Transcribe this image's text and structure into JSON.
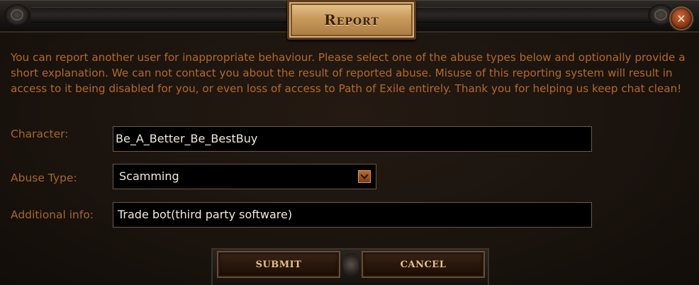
{
  "dialog": {
    "title": "Report",
    "close_icon": "close-icon",
    "message": "You can report another user for inappropriate behaviour. Please select one of the abuse types below and optionally provide a short explanation. We can not contact you about the result of reported abuse. Misuse of this reporting system will result in access to it being disabled for you, or even loss of access to Path of Exile entirely. Thank you for helping us keep chat clean!"
  },
  "form": {
    "character_label": "Character:",
    "character_value": "Be_A_Better_Be_BestBuy",
    "abuse_type_label": "Abuse Type:",
    "abuse_type_value": "Scamming",
    "additional_info_label": "Additional info:",
    "additional_info_value": "Trade bot(third party software)"
  },
  "buttons": {
    "submit_label": "SUBMIT",
    "cancel_label": "CANCEL"
  },
  "colors": {
    "message_text": "#b4692a",
    "label_text": "#a8662c",
    "field_text": "#f2ead8",
    "button_text": "#e3c18c"
  }
}
